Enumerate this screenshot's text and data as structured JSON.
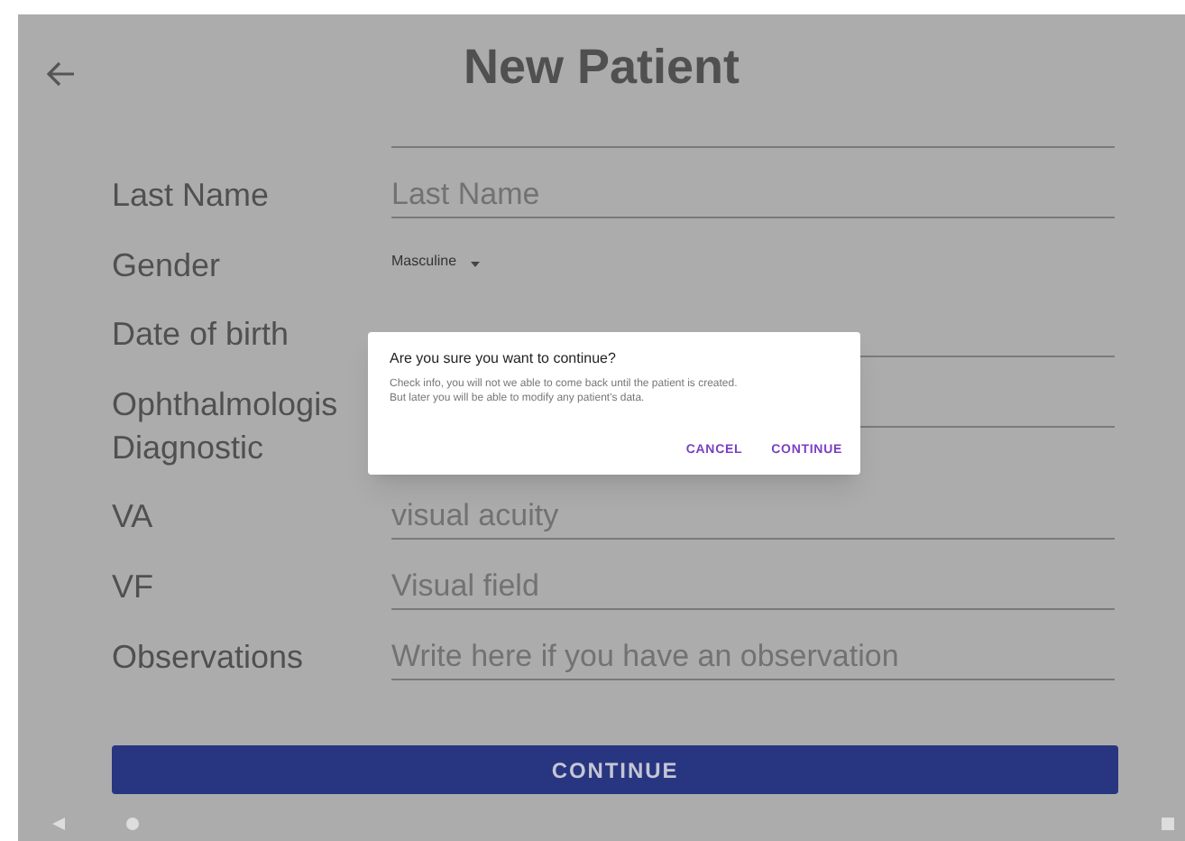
{
  "header": {
    "title": "New Patient"
  },
  "fields": [
    {
      "kind": "text",
      "label": "Last Name",
      "placeholder": "Last Name"
    },
    {
      "kind": "dropdown",
      "label": "Gender",
      "value": "Masculine"
    },
    {
      "kind": "text",
      "label": "Date of birth"
    },
    {
      "kind": "text",
      "label": "Ophthalmologis Diagnostic"
    },
    {
      "kind": "text",
      "label": "VA",
      "placeholder": "visual acuity"
    },
    {
      "kind": "text",
      "label": "VF",
      "placeholder": "Visual field"
    },
    {
      "kind": "text",
      "label": "Observations",
      "placeholder": "Write here if you have an observation"
    }
  ],
  "continue_button": "CONTINUE",
  "dialog": {
    "title": "Are you sure you want to continue?",
    "message": [
      "Check info, you will not we able to come back until the patient is created.",
      "But later you will be able to modify any patient's data."
    ],
    "buttons": [
      "CANCEL",
      "CONTINUE"
    ]
  }
}
